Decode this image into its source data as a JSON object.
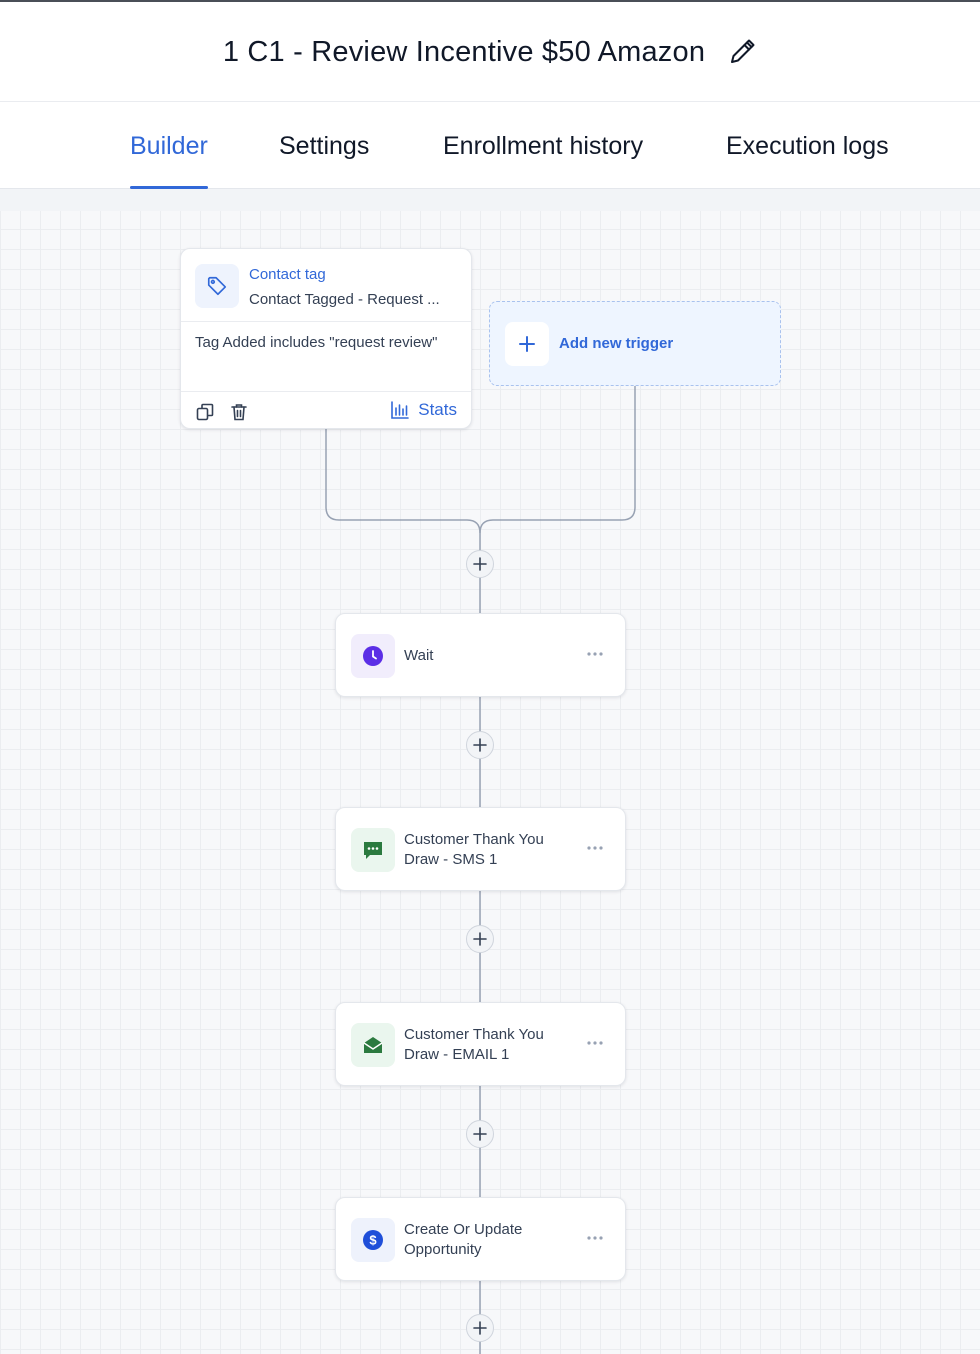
{
  "header": {
    "title": "1 C1 - Review Incentive $50 Amazon",
    "edit_icon": "pencil-icon"
  },
  "tabs": [
    {
      "label": "Builder",
      "active": true
    },
    {
      "label": "Settings",
      "active": false
    },
    {
      "label": "Enrollment history",
      "active": false
    },
    {
      "label": "Execution logs",
      "active": false
    }
  ],
  "trigger": {
    "icon": "tag-icon",
    "name": "Contact tag",
    "subtitle": "Contact Tagged - Request ...",
    "filter": "Tag Added includes \"request review\"",
    "copy_icon": "copy-icon",
    "delete_icon": "trash-icon",
    "stats_icon": "bar-chart-icon",
    "stats_label": "Stats"
  },
  "add_trigger": {
    "label": "Add new trigger",
    "icon": "plus-icon"
  },
  "actions": [
    {
      "line1": "Wait",
      "line2": "",
      "icon": "clock-icon",
      "color": "#5b2ee6",
      "bg": "#f1edfc"
    },
    {
      "line1": "Customer Thank You",
      "line2": "Draw - SMS 1",
      "icon": "chat-icon",
      "color": "#2b7a3f",
      "bg": "#eaf6ee"
    },
    {
      "line1": "Customer Thank You",
      "line2": "Draw - EMAIL 1",
      "icon": "envelope-open-icon",
      "color": "#2b7a3f",
      "bg": "#eaf6ee"
    },
    {
      "line1": "Create Or Update",
      "line2": "Opportunity",
      "icon": "dollar-icon",
      "color": "#1f4fd9",
      "bg": "#eef2fc"
    }
  ],
  "colors": {
    "accent": "#3168d8",
    "text": "#101828",
    "muted": "#344054"
  }
}
